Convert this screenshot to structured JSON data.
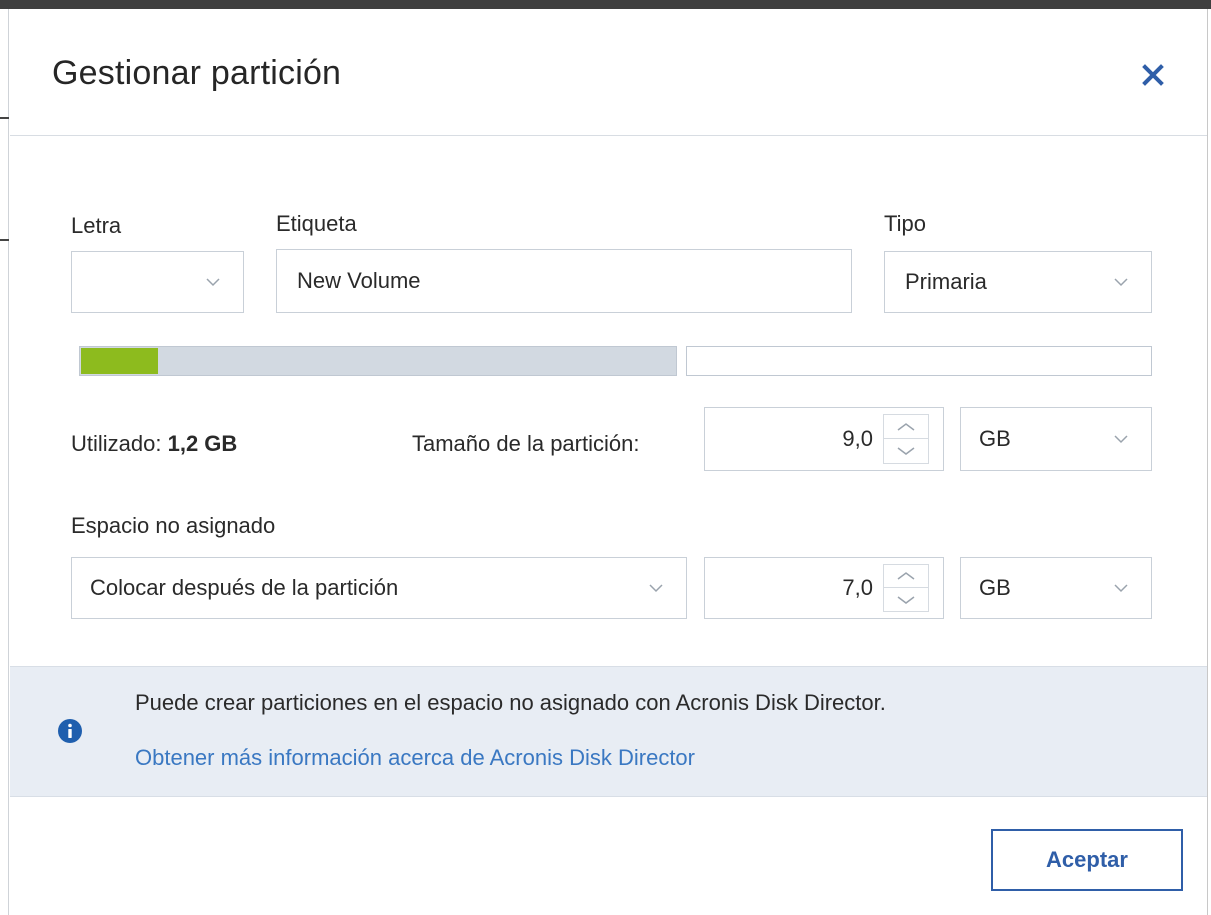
{
  "dialog": {
    "title": "Gestionar partición",
    "close_icon": "close-icon"
  },
  "fields": {
    "letter_label": "Letra",
    "letter_value": "",
    "label_label": "Etiqueta",
    "label_value": "New Volume",
    "type_label": "Tipo",
    "type_value": "Primaria"
  },
  "usage_bar": {
    "used_fraction_of_partition": 0.13,
    "partition_fraction_of_total": 0.5625,
    "colors": {
      "used": "#8dbb1e",
      "partition": "#d2d9e1",
      "unallocated": "#ffffff"
    }
  },
  "used": {
    "label": "Utilizado:",
    "value": "1,2 GB"
  },
  "partition_size": {
    "label": "Tamaño de la partición:",
    "value": "9,0",
    "unit": "GB"
  },
  "unallocated": {
    "label": "Espacio no asignado",
    "placement": "Colocar después de la partición",
    "value": "7,0",
    "unit": "GB"
  },
  "info": {
    "icon": "info-icon",
    "text": "Puede crear particiones en el espacio no asignado con Acronis Disk Director.",
    "link": "Obtener más información acerca de Acronis Disk Director"
  },
  "buttons": {
    "accept": "Aceptar"
  },
  "colors": {
    "accent": "#2f5ea8",
    "link": "#3a78c2",
    "info_bg": "#e8edf4"
  }
}
